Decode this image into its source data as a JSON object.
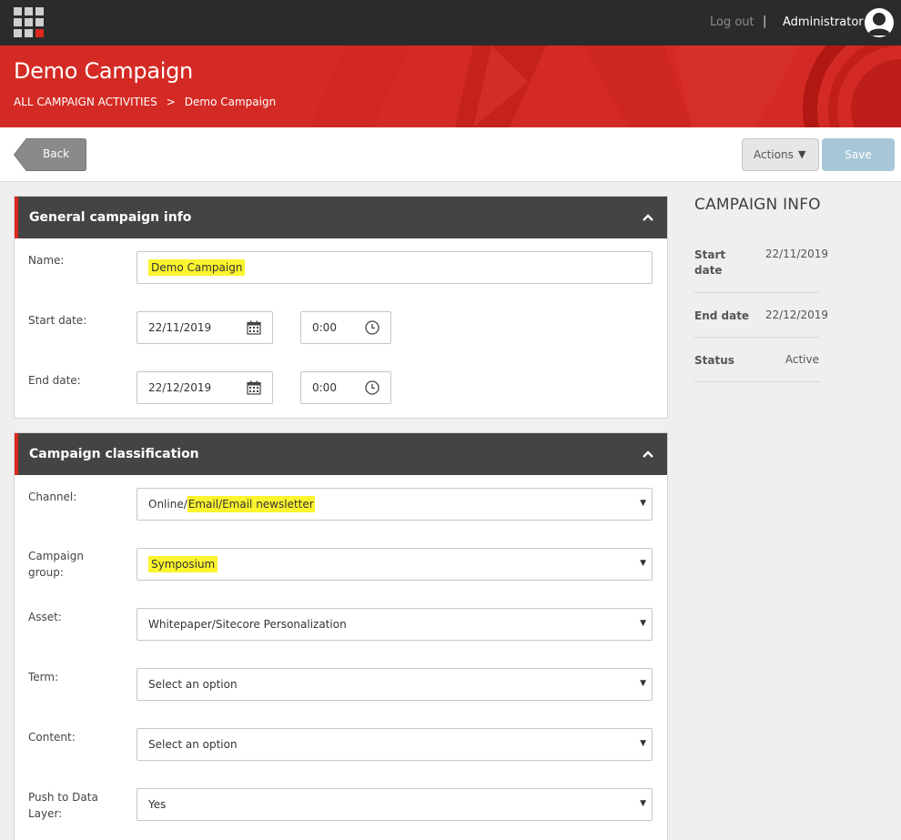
{
  "topbar": {
    "logout": "Log out",
    "separator": "|",
    "user": "Administrator"
  },
  "header": {
    "title": "Demo Campaign",
    "breadcrumb": [
      "ALL CAMPAIGN ACTIVITIES",
      "Demo Campaign"
    ],
    "breadcrumb_chevron": ">"
  },
  "toolbar": {
    "back_label": "Back",
    "actions_label": "Actions",
    "save_label": "Save"
  },
  "general": {
    "title": "General campaign info",
    "name_label": "Name:",
    "name_value": "Demo Campaign",
    "start_label": "Start date:",
    "start_date": "22/11/2019",
    "start_time": "0:00",
    "end_label": "End date:",
    "end_date": "22/12/2019",
    "end_time": "0:00"
  },
  "classification": {
    "title": "Campaign classification",
    "channel_label": "Channel:",
    "channel_prefix": "Online/",
    "channel_highlight": "Email/Email newsletter",
    "group_label": "Campaign group:",
    "group_value": "Symposium",
    "asset_label": "Asset:",
    "asset_value": "Whitepaper/Sitecore Personalization",
    "term_label": "Term:",
    "term_value": "Select an option",
    "content_label": "Content:",
    "content_value": "Select an option",
    "push_label": "Push to Data Layer:",
    "push_value": "Yes"
  },
  "info": {
    "title": "CAMPAIGN INFO",
    "start_label": "Start date",
    "start_value": "22/11/2019",
    "end_label": "End date",
    "end_value": "22/12/2019",
    "status_label": "Status",
    "status_value": "Active"
  },
  "colors": {
    "accent": "#dc291e",
    "topbar": "#2b2b2b",
    "panel_header": "#444444",
    "highlight": "#fbf42e",
    "save_disabled": "#a7c7d8"
  },
  "icons": {
    "launcher": "app-grid-icon",
    "avatar": "user-avatar-icon",
    "calendar": "calendar-icon",
    "clock": "clock-icon",
    "collapse": "chevron-up-icon",
    "dropdown": "caret-down-icon"
  }
}
